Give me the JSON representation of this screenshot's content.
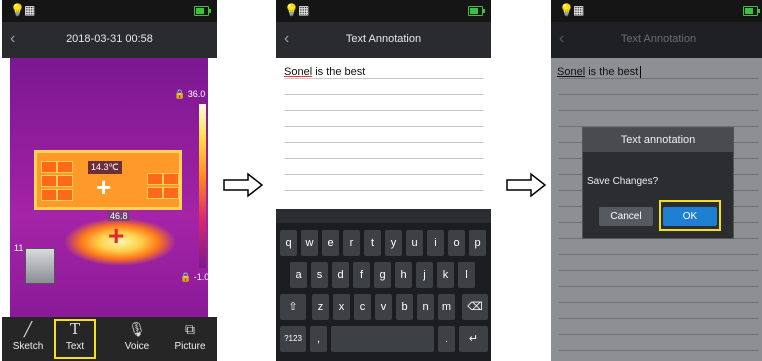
{
  "screen1": {
    "datetime": "2018-03-31 00:58",
    "scale_max": "36.0",
    "scale_min": "-1.0",
    "spot_temp": "14.3℃",
    "hot_temp": "46.8",
    "side_value": "11",
    "toolbar": [
      {
        "label": "Sketch",
        "icon": "pencil-icon"
      },
      {
        "label": "Text",
        "icon": "text-t-icon"
      },
      {
        "label": "Voice",
        "icon": "microphone-icon"
      },
      {
        "label": "Picture",
        "icon": "picture-icon"
      }
    ],
    "selected_tool": "Text"
  },
  "screen2": {
    "title": "Text Annotation",
    "note_word_underlined": "Sonel",
    "note_rest": " is the best",
    "keyboard": {
      "row1": [
        "q",
        "w",
        "e",
        "r",
        "t",
        "y",
        "u",
        "i",
        "o",
        "p"
      ],
      "row2": [
        "a",
        "s",
        "d",
        "f",
        "g",
        "h",
        "j",
        "k",
        "l"
      ],
      "row3": [
        "z",
        "x",
        "c",
        "v",
        "b",
        "n",
        "m"
      ],
      "symbols_key": "?123",
      "comma_key": ",",
      "period_key": "."
    }
  },
  "screen3": {
    "title": "Text Annotation",
    "note_word_underlined": "Sonel",
    "note_rest": " is the best",
    "dialog": {
      "title": "Text annotation",
      "message": "Save Changes?",
      "cancel_label": "Cancel",
      "ok_label": "OK"
    }
  },
  "colors": {
    "highlight": "#f5e11a",
    "ok_button": "#1e7fd3",
    "status_bar": "#151515"
  }
}
